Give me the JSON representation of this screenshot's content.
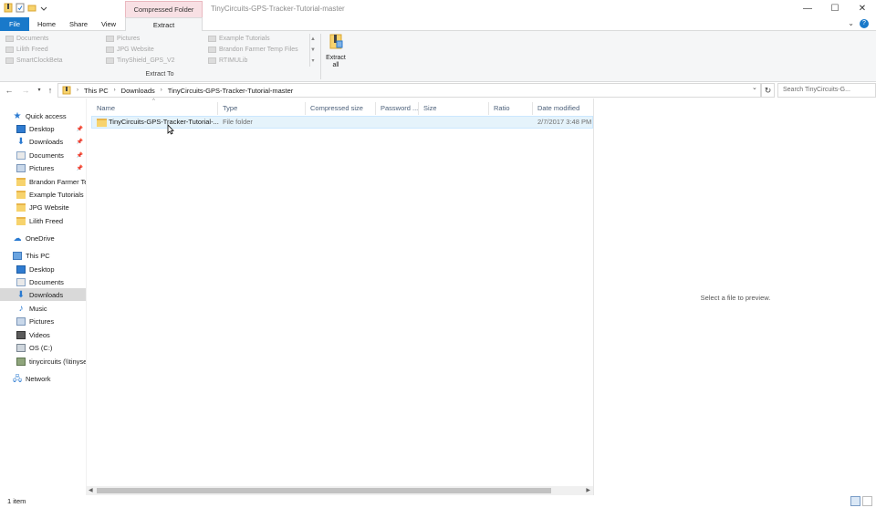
{
  "window": {
    "title": "TinyCircuits-GPS-Tracker-Tutorial-master",
    "context_tab": "Compressed Folder Tools",
    "controls": {
      "minimize": "—",
      "maximize": "☐",
      "close": "✕"
    }
  },
  "ribbon_tabs": {
    "file": "File",
    "home": "Home",
    "share": "Share",
    "view": "View",
    "extract": "Extract"
  },
  "ribbon": {
    "locations": [
      "Documents",
      "Pictures",
      "Example Tutorials",
      "Lilith Freed",
      "JPG Website",
      "Brandon Farmer Temp Files",
      "SmartClockBeta",
      "TinyShield_GPS_V2",
      "RTIMULib"
    ],
    "group_label": "Extract To",
    "extract_all_line1": "Extract",
    "extract_all_line2": "all"
  },
  "address": {
    "crumbs": [
      "This PC",
      "Downloads",
      "TinyCircuits-GPS-Tracker-Tutorial-master"
    ],
    "search_placeholder": "Search TinyCircuits-G..."
  },
  "nav": {
    "quick_access": "Quick access",
    "quick_items": [
      {
        "label": "Desktop",
        "pinned": true
      },
      {
        "label": "Downloads",
        "pinned": true
      },
      {
        "label": "Documents",
        "pinned": true
      },
      {
        "label": "Pictures",
        "pinned": true
      },
      {
        "label": "Brandon Farmer Ter",
        "pinned": false
      },
      {
        "label": "Example Tutorials",
        "pinned": false
      },
      {
        "label": "JPG Website",
        "pinned": false
      },
      {
        "label": "Lilith Freed",
        "pinned": false
      }
    ],
    "onedrive": "OneDrive",
    "this_pc": "This PC",
    "pc_items": [
      "Desktop",
      "Documents",
      "Downloads",
      "Music",
      "Pictures",
      "Videos",
      "OS (C:)",
      "tinycircuits (\\\\tinyse"
    ],
    "network": "Network"
  },
  "columns": [
    "Name",
    "Type",
    "Compressed size",
    "Password ...",
    "Size",
    "Ratio",
    "Date modified"
  ],
  "rows": [
    {
      "name": "TinyCircuits-GPS-Tracker-Tutorial-...",
      "type": "File folder",
      "compressed_size": "",
      "password": "",
      "size": "",
      "ratio": "",
      "date": "2/7/2017 3:48 PM"
    }
  ],
  "preview": {
    "empty_text": "Select a file to preview."
  },
  "status": {
    "count": "1 item"
  },
  "colors": {
    "accent": "#1979ca",
    "selection": "#e5f3fb",
    "context_tab": "#f8e0e4"
  }
}
